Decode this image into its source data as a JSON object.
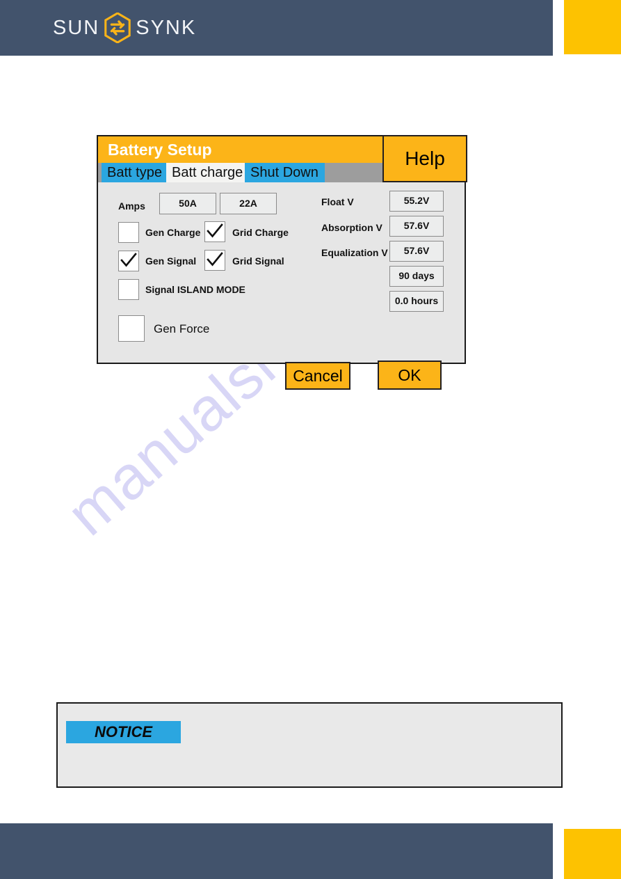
{
  "header": {
    "logo": {
      "word_left": "SUN",
      "word_right": "SYNK",
      "mark": "hexagon-sync-icon"
    }
  },
  "dialog": {
    "title": "Battery Setup",
    "help_label": "Help",
    "tabs": [
      {
        "label": "Batt type",
        "active": false
      },
      {
        "label": "Batt charge",
        "active": true
      },
      {
        "label": "Shut Down",
        "active": false
      }
    ],
    "amps": {
      "label": "Amps",
      "value_1": "50A",
      "value_2": "22A"
    },
    "checkboxes": [
      {
        "label": "Gen Charge",
        "checked": false
      },
      {
        "label": "Grid Charge",
        "checked": true
      },
      {
        "label": "Gen Signal",
        "checked": true
      },
      {
        "label": "Grid Signal",
        "checked": true
      },
      {
        "label": "Signal ISLAND MODE",
        "checked": false
      },
      {
        "label": "Gen Force",
        "checked": false
      }
    ],
    "parameters": [
      {
        "label": "Float V",
        "value": "55.2V"
      },
      {
        "label": "Absorption V",
        "value": "57.6V"
      },
      {
        "label": "Equalization V",
        "value": "57.6V"
      },
      {
        "label": "",
        "value": "90 days"
      },
      {
        "label": "",
        "value": "0.0 hours"
      }
    ],
    "buttons": {
      "cancel": "Cancel",
      "ok": "OK"
    }
  },
  "notice": {
    "badge": "NOTICE",
    "body": ""
  },
  "watermark": {
    "text": "manualshive.com"
  },
  "colors": {
    "brand_dark": "#42536c",
    "brand_yellow": "#fdc201",
    "dialog_orange": "#fcb418",
    "tab_blue": "#2ba6e0",
    "tab_active": "#f4f4f2",
    "tab_strip": "#9d9d9d",
    "dialog_bg": "#e6e6e6"
  }
}
